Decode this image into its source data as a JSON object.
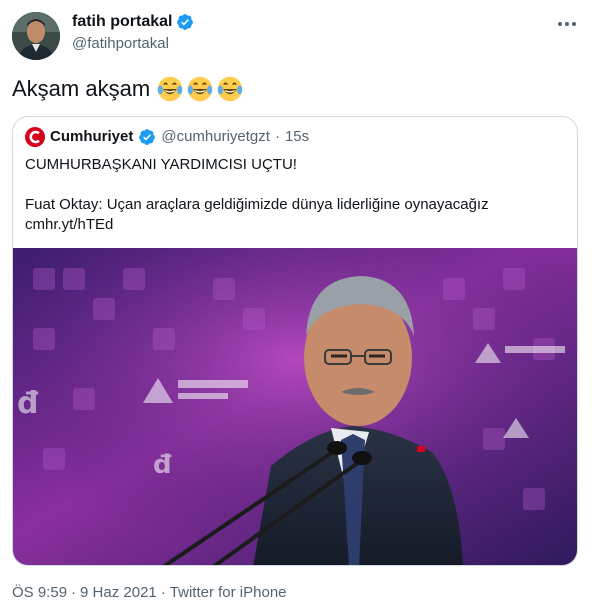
{
  "author": {
    "display_name": "fatih portakal",
    "handle": "@fatihportakal",
    "verified_icon": "verified-badge-icon"
  },
  "tweet": {
    "text": "Akşam akşam",
    "emojis": [
      "face-with-tears-of-joy",
      "face-with-tears-of-joy",
      "face-with-tears-of-joy"
    ]
  },
  "quoted_tweet": {
    "display_name": "Cumhuriyet",
    "handle": "@cumhuriyetgzt",
    "separator": "·",
    "time": "15s",
    "lines": [
      "CUMHURBAŞKANI YARDIMCISI UÇTU!",
      "",
      "Fuat Oktay: Uçan araçlara geldiğimizde dünya liderliğine oynayacağız",
      "cmhr.yt/hTEd"
    ],
    "media_alt": "photo"
  },
  "meta": {
    "time": "ÖS 9:59",
    "dot1": "·",
    "date": "9 Haz 2021",
    "dot2": "·",
    "source": "Twitter for iPhone"
  },
  "colors": {
    "text": "#0f1419",
    "secondary": "#536471",
    "border": "#cfd9de",
    "verified": "#1d9bf0",
    "brand_red": "#d6001c"
  }
}
